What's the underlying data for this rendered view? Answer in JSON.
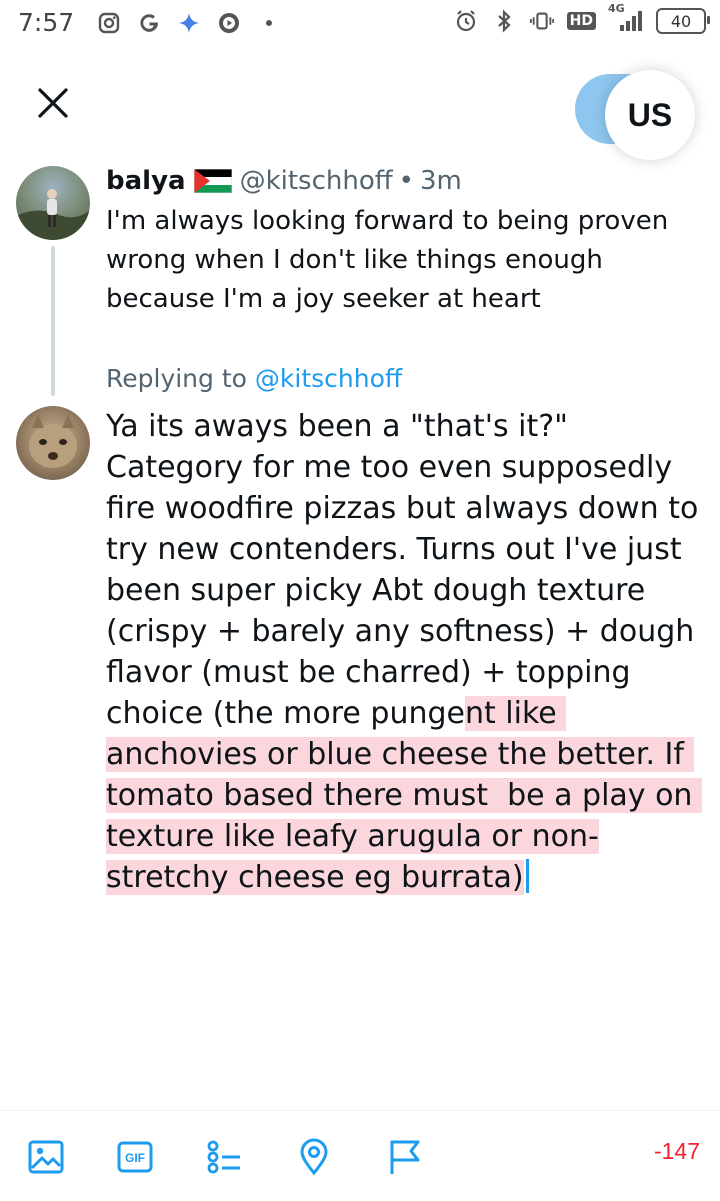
{
  "status_bar": {
    "time": "7:57",
    "network": "4G",
    "battery": "40"
  },
  "header": {
    "avatar_initials": "US"
  },
  "original_tweet": {
    "name": "balya",
    "handle": "@kitschhoff",
    "separator": "•",
    "time": "3m",
    "text": "I'm always looking forward to being proven wrong when I don't like things enough because I'm a joy seeker at heart"
  },
  "reply": {
    "replying_label": "Replying to",
    "replying_handle": "@kitschhoff",
    "text_main": "Ya its aways been a \"that's it?\" Category for me too even supposedly fire woodfire pizzas but always down to try new contenders. Turns out I've just been super picky Abt dough texture (crispy + barely any softness) + dough flavor (must be charred) + topping choice (the more punge",
    "text_over": "nt like anchovies or blue cheese the better. If tomato based there must  be a play on texture like leafy arugula or non-stretchy cheese eg burrata)"
  },
  "composer": {
    "char_count": "-147"
  },
  "colors": {
    "accent": "#1d9bf0",
    "over_limit_highlight": "#fbd7dd",
    "over_limit_count": "#f4212e"
  }
}
